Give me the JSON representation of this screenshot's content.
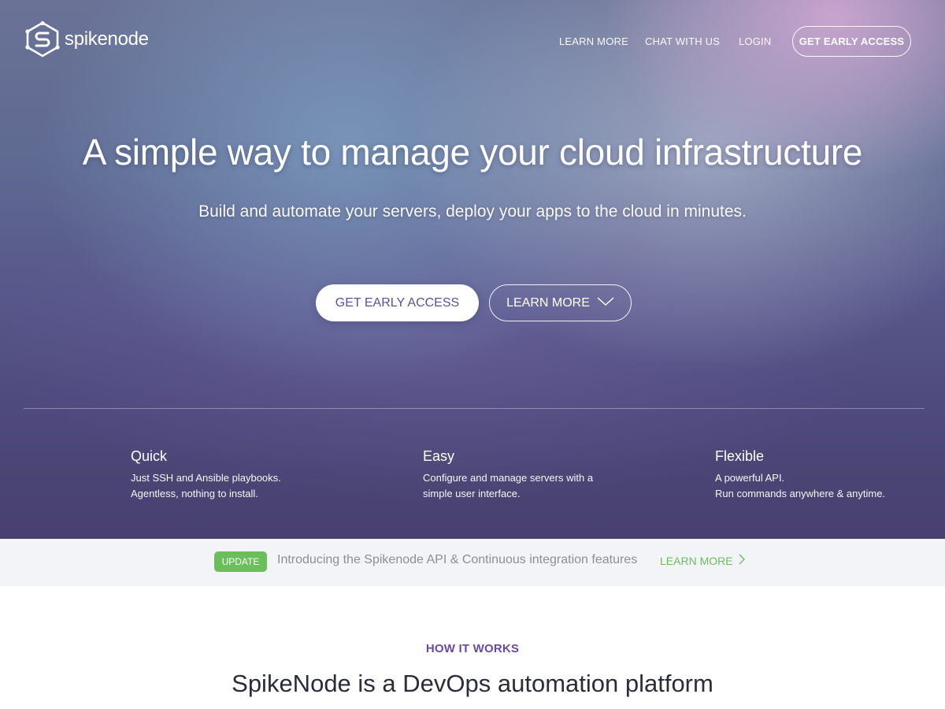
{
  "brand": {
    "name": "spikenode",
    "logo_icon": "spikenode-logo-icon"
  },
  "nav": {
    "links": [
      "LEARN MORE",
      "CHAT WITH US",
      "LOGIN"
    ],
    "cta": "GET EARLY ACCESS"
  },
  "hero": {
    "headline": "A simple way to manage your cloud infrastructure",
    "subheadline": "Build and automate your servers, deploy your apps to the cloud in minutes.",
    "primary_button": "GET EARLY ACCESS",
    "secondary_button": "LEARN MORE",
    "secondary_icon": "chevron-down-icon"
  },
  "features": [
    {
      "title": "Quick",
      "lines": [
        "Just SSH and Ansible playbooks.",
        "Agentless, nothing to install."
      ]
    },
    {
      "title": "Easy",
      "lines": [
        "Configure and manage servers with a",
        "simple user interface."
      ]
    },
    {
      "title": "Flexible",
      "lines": [
        "A powerful API.",
        "Run commands anywhere & anytime."
      ]
    }
  ],
  "update": {
    "badge": "UPDATE",
    "text": "Introducing the Spikenode API & Continuous integration features",
    "link": "LEARN MORE",
    "link_icon": "chevron-right-icon"
  },
  "how_it_works": {
    "label": "HOW IT WORKS",
    "title": "SpikeNode is a DevOps automation platform"
  },
  "colors": {
    "accent_purple": "#5b5196",
    "update_green": "#6bbf5a",
    "section_label": "#6a4aa0",
    "update_bar_bg": "#f2f4f8"
  }
}
